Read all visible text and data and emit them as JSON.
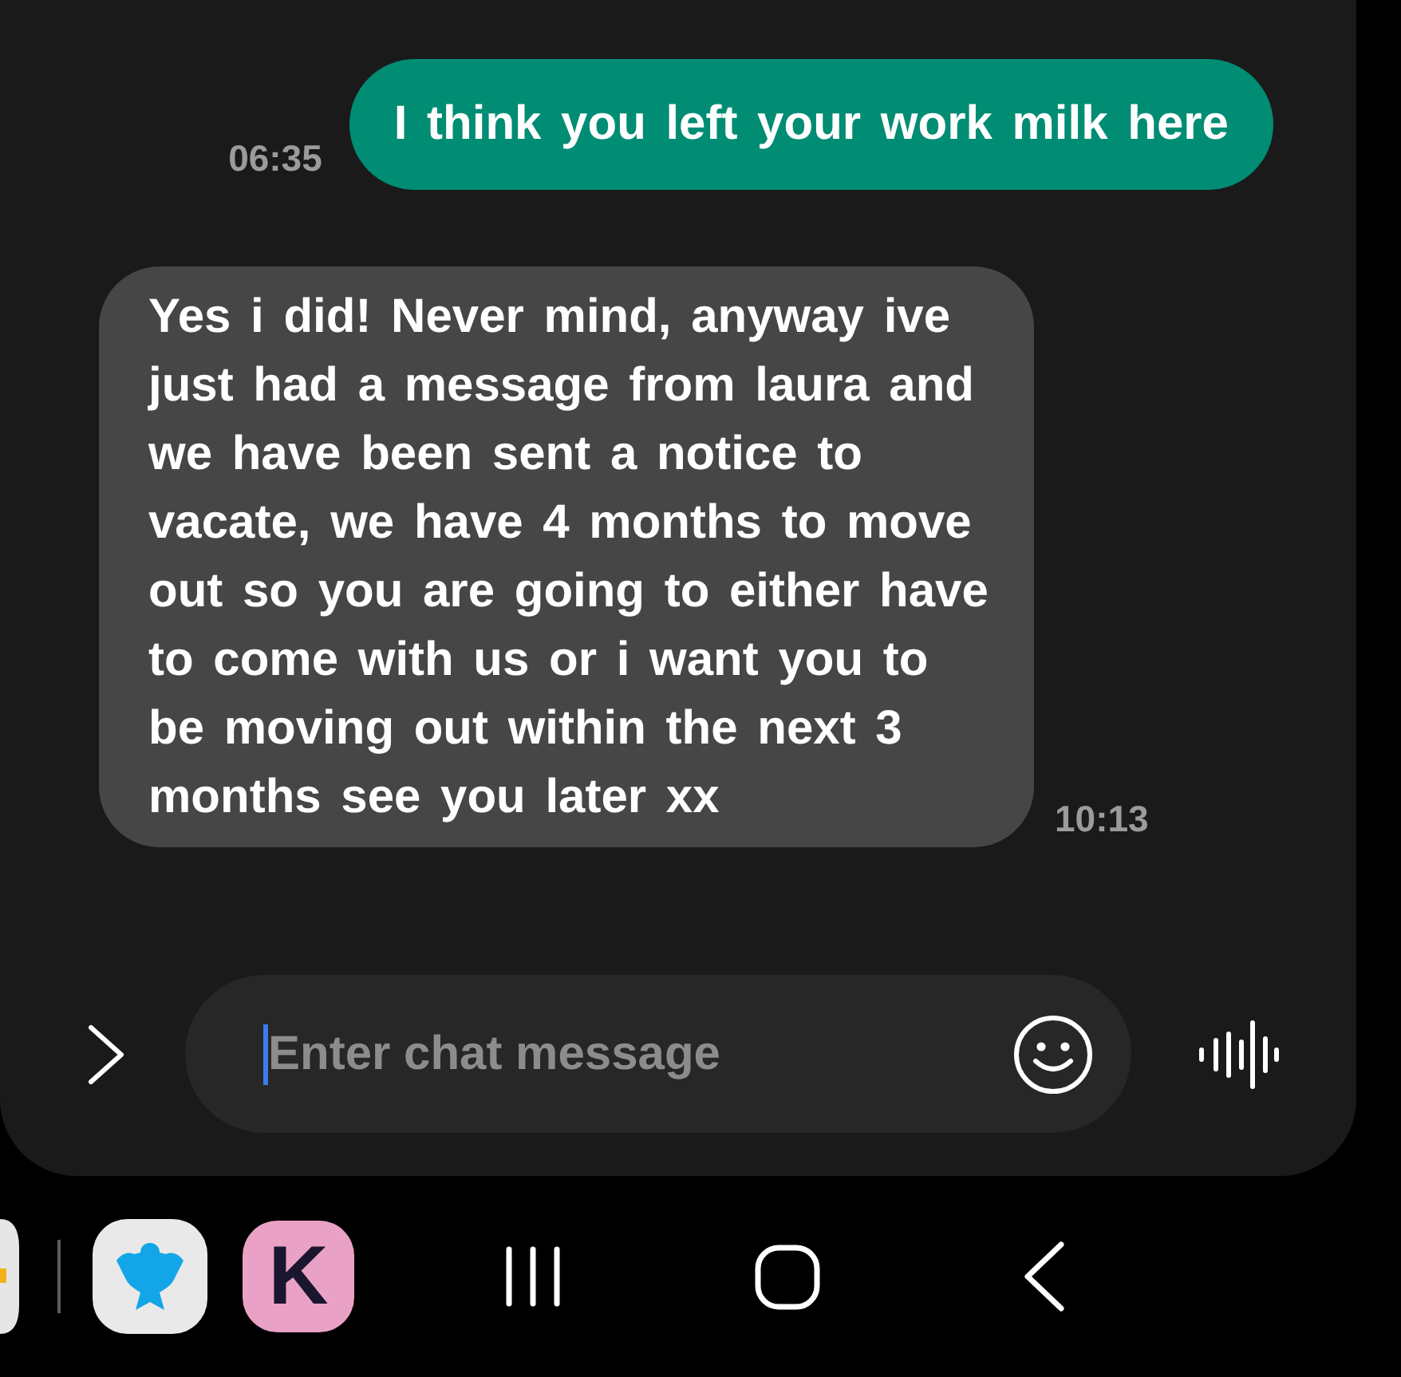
{
  "messages": [
    {
      "kind": "sent",
      "text": "I think you left your work milk here",
      "time": "06:35"
    },
    {
      "kind": "received",
      "text": "Yes i did! Never mind, anyway ive just had a message from laura and we have been sent a notice to vacate, we have 4 months to move out so you are going to either have to come with us or i want you to be moving out within the next 3 months see you later xx",
      "time": "10:13"
    }
  ],
  "composer": {
    "placeholder": "Enter chat message",
    "focused": true
  },
  "taskbar": {
    "apps": [
      {
        "kind": "partial"
      },
      {
        "kind": "eagle"
      },
      {
        "kind": "letter",
        "label": "K"
      }
    ],
    "nav_buttons": [
      {
        "kind": "recents"
      },
      {
        "kind": "home"
      },
      {
        "kind": "back"
      }
    ]
  }
}
